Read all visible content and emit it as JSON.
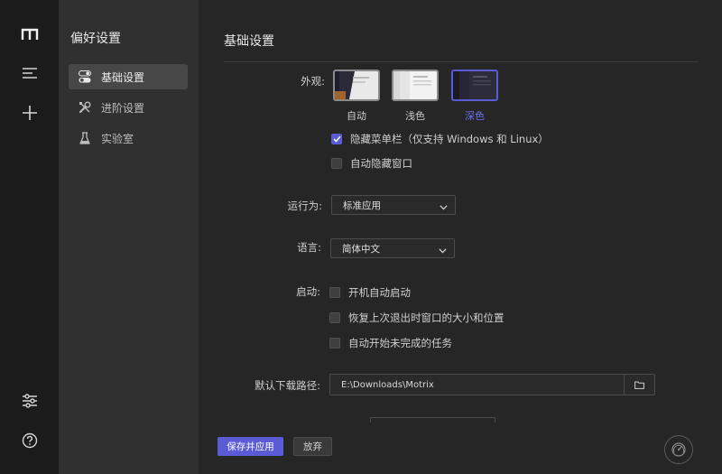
{
  "sidebar": {
    "title": "偏好设置",
    "items": [
      {
        "label": "基础设置",
        "icon": "toggle-icon",
        "active": true
      },
      {
        "label": "进阶设置",
        "icon": "tools-icon",
        "active": false
      },
      {
        "label": "实验室",
        "icon": "flask-icon",
        "active": false
      }
    ]
  },
  "rail": {
    "icons": [
      "motrix-logo-icon",
      "task-list-icon",
      "add-task-icon",
      "preferences-icon",
      "help-icon"
    ]
  },
  "main": {
    "title": "基础设置",
    "appearance": {
      "label": "外观:",
      "options": [
        {
          "label": "自动",
          "selected": false
        },
        {
          "label": "浅色",
          "selected": false
        },
        {
          "label": "深色",
          "selected": true
        }
      ],
      "hide_menubar": {
        "label": "隐藏菜单栏（仅支持 Windows 和 Linux）",
        "checked": true
      },
      "auto_hide_window": {
        "label": "自动隐藏窗口",
        "checked": false
      }
    },
    "run_mode": {
      "label": "运行为:",
      "value": "标准应用"
    },
    "language": {
      "label": "语言:",
      "value": "简体中文"
    },
    "startup": {
      "label": "启动:",
      "options": [
        {
          "label": "开机自动启动",
          "checked": false
        },
        {
          "label": "恢复上次退出时窗口的大小和位置",
          "checked": false
        },
        {
          "label": "自动开始未完成的任务",
          "checked": false
        }
      ]
    },
    "download_path": {
      "label": "默认下载路径:",
      "value": "E:\\Downloads\\Motrix"
    }
  },
  "footer": {
    "save_label": "保存并应用",
    "discard_label": "放弃"
  },
  "colors": {
    "accent": "#5b5bd6",
    "rail_bg": "#1b1b1b",
    "subnav_bg": "#303030",
    "main_bg": "#262626"
  }
}
